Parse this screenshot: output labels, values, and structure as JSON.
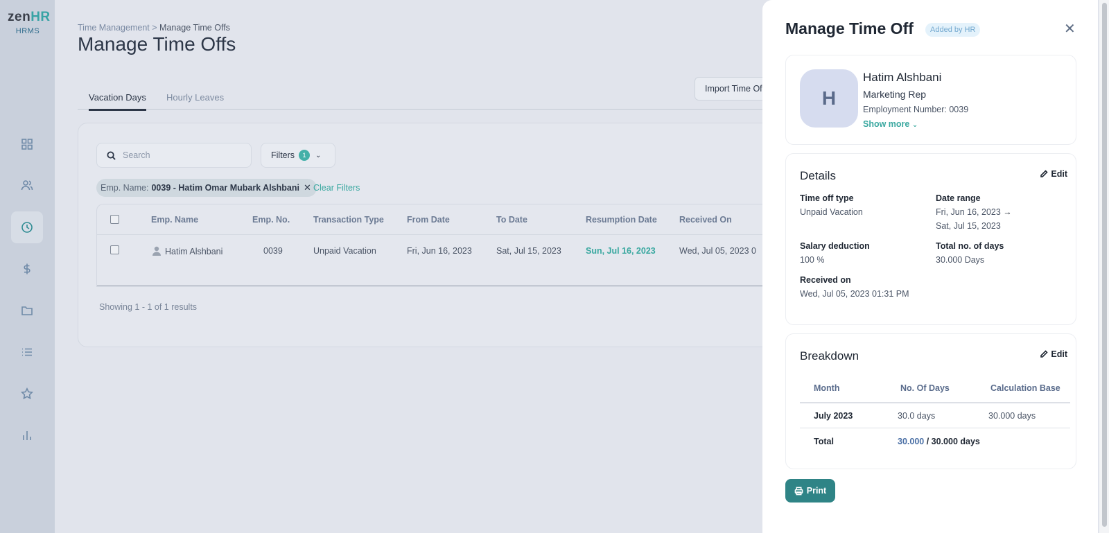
{
  "logo": {
    "brand_a": "zen",
    "brand_b": "HR",
    "sub": "HRMS"
  },
  "sidebar": {
    "items": [
      {
        "icon": "dashboard-icon"
      },
      {
        "icon": "people-icon"
      },
      {
        "icon": "clock-icon",
        "active": true
      },
      {
        "icon": "dollar-icon"
      },
      {
        "icon": "folder-icon"
      },
      {
        "icon": "list-icon"
      },
      {
        "icon": "star-icon"
      },
      {
        "icon": "bar-chart-icon"
      }
    ]
  },
  "breadcrumb": {
    "parent": "Time Management",
    "separator": ">",
    "current": "Manage Time Offs"
  },
  "page": {
    "title": "Manage Time Offs"
  },
  "tabs": [
    {
      "label": "Vacation Days"
    },
    {
      "label": "Hourly Leaves"
    }
  ],
  "import_button": "Import Time Of",
  "search": {
    "placeholder": "Search"
  },
  "filters": {
    "label": "Filters",
    "count": "1"
  },
  "chip": {
    "prefix": "Emp. Name:",
    "value": "0039 - Hatim Omar Mubark Alshbani"
  },
  "clear_filters": "Clear Filters",
  "table": {
    "columns": [
      "Emp. Name",
      "Emp. No.",
      "Transaction Type",
      "From Date",
      "To Date",
      "Resumption Date",
      "Received On"
    ],
    "rows": [
      {
        "name": "Hatim Alshbani",
        "number": "0039",
        "type": "Unpaid Vacation",
        "from": "Fri, Jun 16, 2023",
        "to": "Sat, Jul 15, 2023",
        "resumption": "Sun, Jul 16, 2023",
        "received": "Wed, Jul 05, 2023 0"
      }
    ]
  },
  "showing": "Showing 1 - 1 of 1 results",
  "drawer": {
    "title": "Manage Time Off",
    "badge": "Added by HR",
    "profile": {
      "initial": "H",
      "name": "Hatim Alshbani",
      "role": "Marketing Rep",
      "employment_number": "Employment Number: 0039",
      "show_more": "Show more"
    },
    "details": {
      "title": "Details",
      "edit": "Edit",
      "time_off_type_label": "Time off type",
      "time_off_type": "Unpaid Vacation",
      "date_range_label": "Date range",
      "date_from": "Fri, Jun 16, 2023",
      "date_to": "Sat, Jul 15, 2023",
      "salary_deduction_label": "Salary deduction",
      "salary_deduction": "100 %",
      "total_days_label": "Total no. of days",
      "total_days": "30.000 Days",
      "received_on_label": "Received on",
      "received_on": "Wed, Jul 05, 2023 01:31 PM"
    },
    "breakdown": {
      "title": "Breakdown",
      "edit": "Edit",
      "columns": [
        "Month",
        "No. Of Days",
        "Calculation Base"
      ],
      "rows": [
        {
          "month": "July 2023",
          "days": "30.0 days",
          "base": "30.000 days"
        }
      ],
      "total_label": "Total",
      "total_value": "30.000",
      "total_of": "/ 30.000 days"
    },
    "print": "Print"
  }
}
